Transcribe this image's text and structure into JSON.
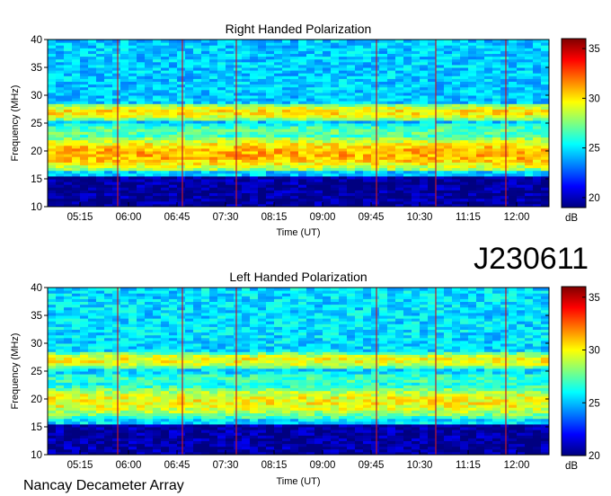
{
  "id_label": "J230611",
  "footer": "Nancay Decameter Array",
  "colorbar": {
    "unit": "dB",
    "ticks": [
      20,
      25,
      30,
      35
    ],
    "range": [
      19,
      36
    ],
    "colors": [
      "#00007f",
      "#0000ff",
      "#007fff",
      "#00ffff",
      "#7fff7f",
      "#ffff00",
      "#ff7f00",
      "#ff0000",
      "#7f0000"
    ]
  },
  "chart_data": [
    {
      "type": "heatmap",
      "title": "Right Handed Polarization",
      "xlabel": "Time (UT)",
      "ylabel": "Frequency (MHz)",
      "x_ticks": [
        "05:15",
        "06:00",
        "06:45",
        "07:30",
        "08:15",
        "09:00",
        "09:45",
        "10:30",
        "11:15",
        "12:00"
      ],
      "y_ticks": [
        10,
        15,
        20,
        25,
        30,
        35,
        40
      ],
      "ylim": [
        10,
        40
      ],
      "xlim": [
        "04:45",
        "12:30"
      ],
      "value_unit": "dB",
      "zlim": [
        19,
        36
      ],
      "emission_bands": [
        {
          "freq_low": 17,
          "freq_high": 22,
          "level": 31
        },
        {
          "freq_low": 26,
          "freq_high": 28,
          "level": 30
        },
        {
          "freq_low": 22,
          "freq_high": 25,
          "level": 27
        }
      ],
      "vertical_lines_time": [
        "05:50",
        "06:50",
        "07:40",
        "09:50",
        "10:45",
        "11:50"
      ]
    },
    {
      "type": "heatmap",
      "title": "Left Handed Polarization",
      "xlabel": "Time (UT)",
      "ylabel": "Frequency (MHz)",
      "x_ticks": [
        "05:15",
        "06:00",
        "06:45",
        "07:30",
        "08:15",
        "09:00",
        "09:45",
        "10:30",
        "11:15",
        "12:00"
      ],
      "y_ticks": [
        10,
        15,
        20,
        25,
        30,
        35,
        40
      ],
      "ylim": [
        10,
        40
      ],
      "xlim": [
        "04:45",
        "12:30"
      ],
      "value_unit": "dB",
      "zlim": [
        20,
        36
      ],
      "emission_bands": [
        {
          "freq_low": 17,
          "freq_high": 22,
          "level": 30
        },
        {
          "freq_low": 26,
          "freq_high": 28,
          "level": 30
        },
        {
          "freq_low": 22,
          "freq_high": 25,
          "level": 27
        }
      ],
      "vertical_lines_time": [
        "05:50",
        "06:50",
        "07:40",
        "09:50",
        "10:45",
        "11:50"
      ]
    }
  ]
}
